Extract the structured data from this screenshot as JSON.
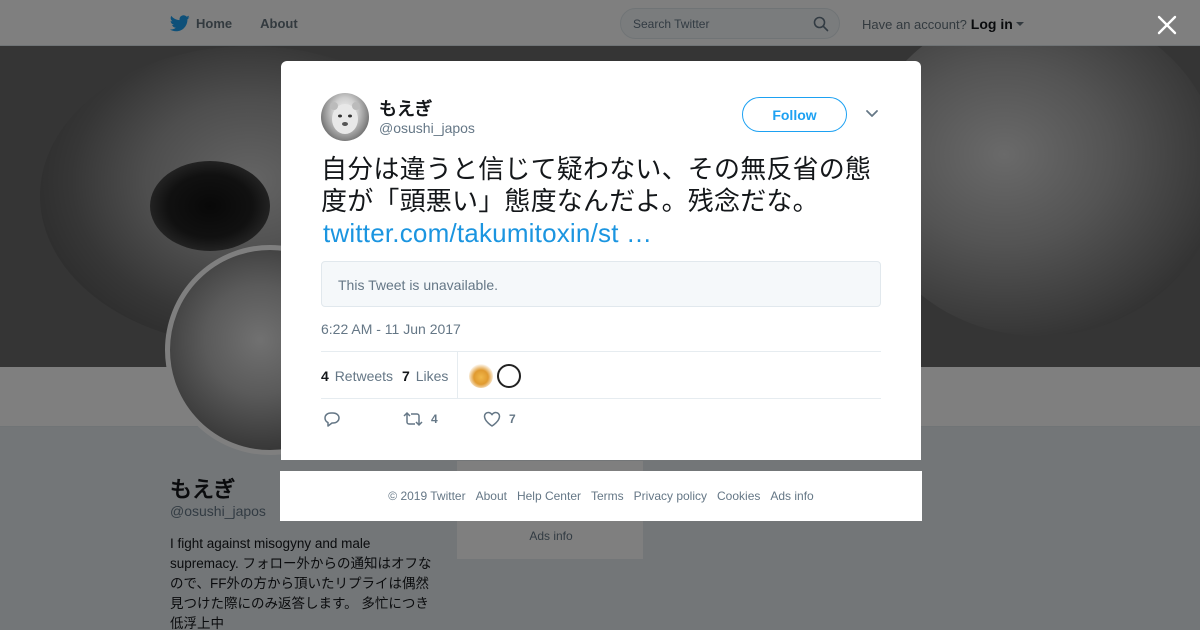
{
  "nav": {
    "home_label": "Home",
    "about_label": "About",
    "search_placeholder": "Search Twitter",
    "have_account": "Have an account?",
    "login_label": "Log in"
  },
  "profile": {
    "name": "もえぎ",
    "handle": "@osushi_japos",
    "bio": "I fight against misogyny and male supremacy. フォロー外からの通知はオフなので、FF外の方から頂いたリプライは偶然見つけた際にのみ返答します。 多忙につき低浮上中"
  },
  "side_card": {
    "partial_text": "Privacy policy · Cookies",
    "ads_info": "Ads info"
  },
  "tweet": {
    "author_name": "もえぎ",
    "author_handle": "@osushi_japos",
    "follow_label": "Follow",
    "text": "自分は違うと信じて疑わない、その無反省の態度が「頭悪い」態度なんだよ。残念だな。",
    "link": "twitter.com/takumitoxin/st …",
    "quoted_unavailable": "This Tweet is unavailable.",
    "timestamp": "6:22 AM - 11 Jun 2017",
    "retweets_count": "4",
    "retweets_label": "Retweets",
    "likes_count": "7",
    "likes_label": "Likes",
    "action_retweet_count": "4",
    "action_like_count": "7"
  },
  "footer": {
    "copyright": "© 2019 Twitter",
    "about": "About",
    "help_center": "Help Center",
    "terms": "Terms",
    "privacy": "Privacy policy",
    "cookies": "Cookies",
    "ads_info": "Ads info"
  },
  "colors": {
    "brand_blue": "#1da1f2",
    "link_blue": "#1b95e0",
    "muted_text": "#657786"
  },
  "icons": [
    "twitter-bird-icon",
    "home-icon",
    "search-icon",
    "caret-down-icon",
    "close-icon",
    "chevron-down-icon",
    "reply-icon",
    "retweet-icon",
    "heart-icon"
  ]
}
